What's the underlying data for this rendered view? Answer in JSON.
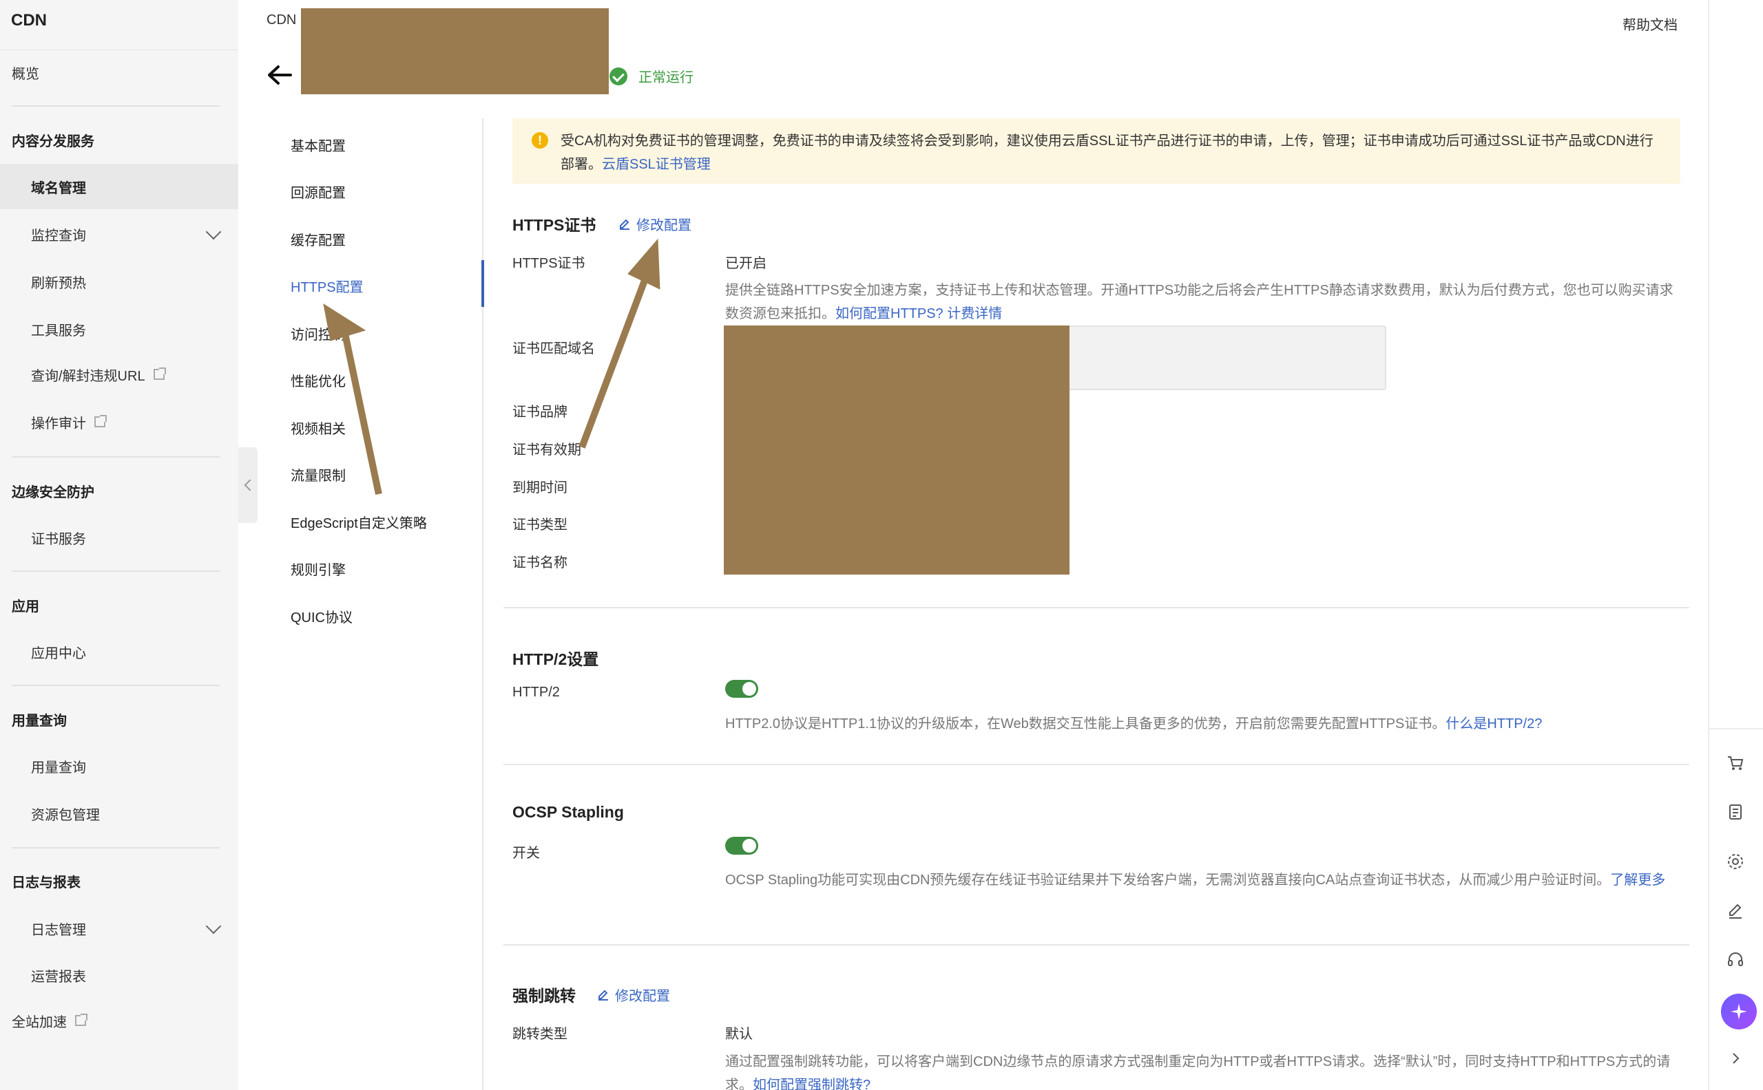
{
  "sidebar": {
    "title": "CDN",
    "overview": "概览",
    "groups": {
      "content_delivery": "内容分发服务",
      "edge_security": "边缘安全防护",
      "apps": "应用",
      "usage": "用量查询",
      "logs_reports": "日志与报表"
    },
    "items": {
      "domain_mgmt": "域名管理",
      "monitoring": "监控查询",
      "refresh_preheat": "刷新预热",
      "tools": "工具服务",
      "url_block": "查询/解封违规URL",
      "audit": "操作审计",
      "cert_service": "证书服务",
      "app_center": "应用中心",
      "usage_query": "用量查询",
      "package_mgmt": "资源包管理",
      "log_mgmt": "日志管理",
      "ops_report": "运营报表",
      "global_accel": "全站加速"
    }
  },
  "header": {
    "breadcrumb": "CDN",
    "status": "正常运行",
    "help": "帮助文档"
  },
  "subnav": [
    "基本配置",
    "回源配置",
    "缓存配置",
    "HTTPS配置",
    "访问控制",
    "性能优化",
    "视频相关",
    "流量限制",
    "EdgeScript自定义策略",
    "规则引擎",
    "QUIC协议"
  ],
  "notice": {
    "text": "受CA机构对免费证书的管理调整，免费证书的申请及续签将会受到影响，建议使用云盾SSL证书产品进行证书的申请，上传，管理；证书申请成功后可通过SSL证书产品或CDN进行部署。",
    "link": "云盾SSL证书管理"
  },
  "https_cert": {
    "title": "HTTPS证书",
    "edit": "修改配置",
    "label": "HTTPS证书",
    "value": "已开启",
    "desc": "提供全链路HTTPS安全加速方案，支持证书上传和状态管理。开通HTTPS功能之后将会产生HTTPS静态请求数费用，默认为后付费方式，您也可以购买请求数资源包来抵扣。",
    "link1": "如何配置HTTPS?",
    "link2": "计费详情",
    "fields": [
      "证书匹配域名",
      "证书品牌",
      "证书有效期",
      "到期时间",
      "证书类型",
      "证书名称"
    ]
  },
  "http2": {
    "title": "HTTP/2设置",
    "label": "HTTP/2",
    "enabled": true,
    "desc": "HTTP2.0协议是HTTP1.1协议的升级版本，在Web数据交互性能上具备更多的优势，开启前您需要先配置HTTPS证书。",
    "link": "什么是HTTP/2?"
  },
  "ocsp": {
    "title": "OCSP Stapling",
    "label": "开关",
    "enabled": true,
    "desc": "OCSP Stapling功能可实现由CDN预先缓存在线证书验证结果并下发给客户端，无需浏览器直接向CA站点查询证书状态，从而减少用户验证时间。",
    "link": "了解更多"
  },
  "force_redirect": {
    "title": "强制跳转",
    "edit": "修改配置",
    "label": "跳转类型",
    "value": "默认",
    "desc": "通过配置强制跳转功能，可以将客户端到CDN边缘节点的原请求方式强制重定向为HTTP或者HTTPS请求。选择“默认”时，同时支持HTTP和HTTPS方式的请求。",
    "link": "如何配置强制跳转?"
  },
  "colors": {
    "accent": "#3a66c4",
    "success": "#43a047",
    "redaction": "#9a7b4f",
    "notice_bg": "#fdf6e0"
  },
  "icons": {
    "rail": [
      "cart-icon",
      "document-icon",
      "gear-icon",
      "edit-icon",
      "headset-icon",
      "ai-assistant-icon",
      "chevron-right-icon"
    ]
  }
}
